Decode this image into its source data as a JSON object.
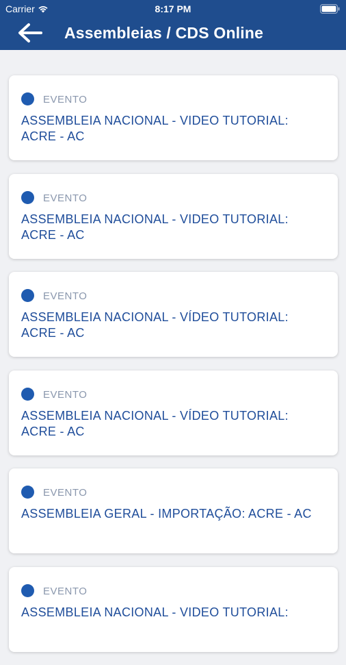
{
  "status_bar": {
    "carrier": "Carrier",
    "time": "8:17 PM"
  },
  "header": {
    "title": "Assembleias / CDS Online",
    "background_color": "#1f4d8e",
    "back_icon": "arrow-left-icon"
  },
  "events": [
    {
      "tag": "EVENTO",
      "title": "ASSEMBLEIA NACIONAL - VIDEO TUTORIAL: ACRE - AC"
    },
    {
      "tag": "EVENTO",
      "title": "ASSEMBLEIA NACIONAL - VIDEO TUTORIAL: ACRE - AC"
    },
    {
      "tag": "EVENTO",
      "title": "ASSEMBLEIA NACIONAL - VÍDEO TUTORIAL: ACRE - AC"
    },
    {
      "tag": "EVENTO",
      "title": "ASSEMBLEIA NACIONAL - VÍDEO TUTORIAL: ACRE - AC"
    },
    {
      "tag": "EVENTO",
      "title": "ASSEMBLEIA GERAL - IMPORTAÇÃO: ACRE - AC"
    },
    {
      "tag": "EVENTO",
      "title": "ASSEMBLEIA NACIONAL - VIDEO TUTORIAL:"
    }
  ],
  "colors": {
    "dot": "#1f5bb0",
    "title_text": "#1f4d9a",
    "tag_text": "#8a97ad",
    "page_background": "#f0f1f4"
  }
}
